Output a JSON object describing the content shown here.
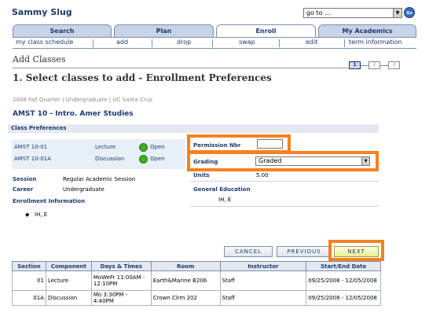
{
  "header": {
    "student_name": "Sammy Slug",
    "goto_value": "go to ...",
    "go_label": "Go"
  },
  "tabs": [
    {
      "label": "Search"
    },
    {
      "label": "Plan"
    },
    {
      "label": "Enroll"
    },
    {
      "label": "My Academics"
    }
  ],
  "subnav": [
    "my class schedule",
    "add",
    "drop",
    "swap",
    "edit",
    "term information"
  ],
  "page": {
    "title": "Add Classes",
    "heading": "1.  Select classes to add - Enrollment Preferences",
    "steps": [
      "1",
      "2",
      "3"
    ],
    "term_info": "2008 Fall Quarter | Undergraduate | UC Santa Cruz",
    "course_title": "AMST  10 - Intro. Amer Studies"
  },
  "prefs": {
    "section_title": "Class Preferences",
    "components": [
      {
        "section": "AMST  10-01",
        "type": "Lecture",
        "status": "Open"
      },
      {
        "section": "AMST  10-01A",
        "type": "Discussion",
        "status": "Open"
      }
    ],
    "session_label": "Session",
    "session_value": "Regular Academic Session",
    "career_label": "Career",
    "career_value": "Undergraduate",
    "enroll_info_label": "Enrollment Information",
    "enroll_info_item": "IH, E",
    "permission_label": "Permission Nbr",
    "permission_value": "",
    "grading_label": "Grading",
    "grading_value": "Graded",
    "units_label": "Units",
    "units_value": "5.00",
    "gen_ed_label": "General Education",
    "gen_ed_value": "IH, E"
  },
  "buttons": {
    "cancel": "CANCEL",
    "previous": "PREVIOUS",
    "next": "NEXT"
  },
  "schedule": {
    "headers": [
      "Section",
      "Component",
      "Days & Times",
      "Room",
      "Instructor",
      "Start/End Date"
    ],
    "rows": [
      {
        "section": "01",
        "component": "Lecture",
        "days_times": "MoWeFr 11:00AM - 12:10PM",
        "room": "Earth&Marine B206",
        "instructor": "Staff",
        "dates": "09/25/2008 - 12/05/2008"
      },
      {
        "section": "01A",
        "component": "Discussion",
        "days_times": "Mo 3:30PM - 4:40PM",
        "room": "Crown Clrm 202",
        "instructor": "Staff",
        "dates": "09/25/2008 - 12/05/2008"
      }
    ]
  },
  "colors": {
    "highlight": "#f5821f",
    "brand": "#1d3a6e",
    "open_status": "#3fb020"
  }
}
